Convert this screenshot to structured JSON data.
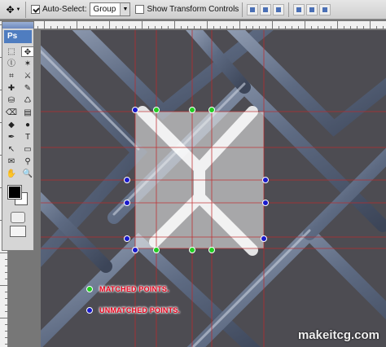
{
  "options_bar": {
    "auto_select_label": "Auto-Select:",
    "auto_select_checked": true,
    "auto_select_value": "Group",
    "show_transform_label": "Show Transform Controls",
    "show_transform_checked": false
  },
  "toolbox": {
    "app_label": "Ps",
    "tools": [
      "marquee-icon",
      "move-icon",
      "lasso-icon",
      "magic-wand-icon",
      "crop-icon",
      "slice-icon",
      "healing-icon",
      "brush-icon",
      "stamp-icon",
      "history-brush-icon",
      "eraser-icon",
      "gradient-icon",
      "blur-icon",
      "dodge-icon",
      "pen-icon",
      "type-icon",
      "path-select-icon",
      "shape-icon",
      "notes-icon",
      "eyedropper-icon",
      "hand-icon",
      "zoom-icon"
    ],
    "tool_glyphs": [
      "⬚",
      "✥",
      "ⓛ",
      "✶",
      "⌗",
      "⚔",
      "✚",
      "✎",
      "⛁",
      "♺",
      "⌫",
      "▤",
      "◆",
      "●",
      "✒",
      "T",
      "↖",
      "▭",
      "✉",
      "⚲",
      "✋",
      "🔍"
    ],
    "foreground_color": "#000000",
    "background_color": "#ffffff"
  },
  "legend": {
    "matched_label": "MATCHED POINTS.",
    "matched_color": "#22cc22",
    "unmatched_label": "UNMATCHED POINTS.",
    "unmatched_color": "#1a1acc"
  },
  "watermark": "makeitcg.com",
  "colors": {
    "guide": "#c0282a",
    "selection_fill": "#f2f2f0",
    "fence_wire": "#5f6d85"
  }
}
